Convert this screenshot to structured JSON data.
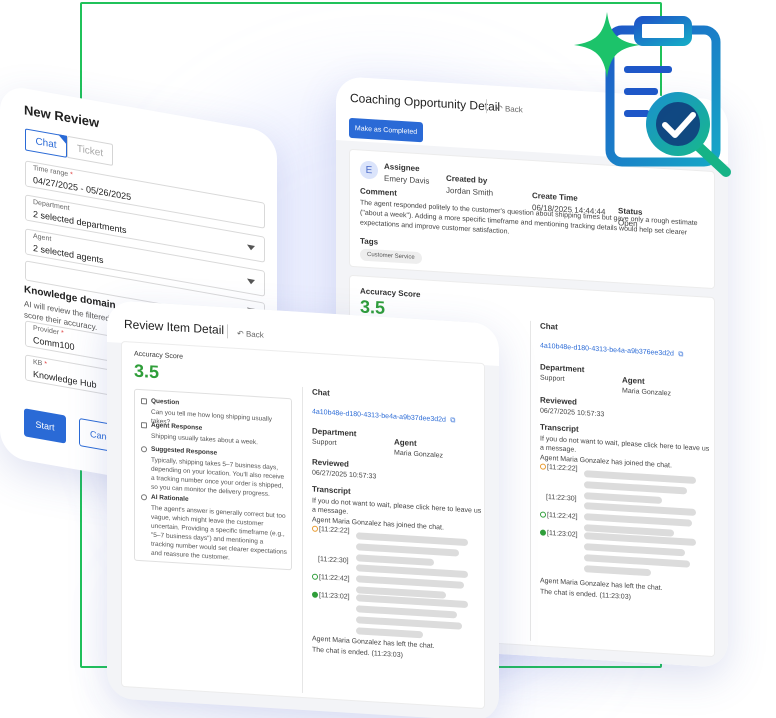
{
  "new_review": {
    "title": "New Review",
    "tabs": {
      "chat": "Chat",
      "ticket": "Ticket"
    },
    "time_range": {
      "label": "Time range",
      "value": "04/27/2025 - 05/26/2025"
    },
    "department": {
      "label": "Department",
      "value": "2 selected departments"
    },
    "agent": {
      "label": "Agent",
      "value": "2 selected agents"
    },
    "knowledge_domain": {
      "title": "Knowledge domain",
      "desc": "AI will review the filtered chats against your knowledge base and score their accuracy."
    },
    "provider": {
      "label": "Provider",
      "value": "Comm100"
    },
    "kb": {
      "label": "KB",
      "value": "Knowledge Hub"
    },
    "start": "Start",
    "cancel": "Cancel"
  },
  "coaching": {
    "title": "Coaching Opportunity Detail",
    "back": "Back",
    "mark_completed": "Make as Completed",
    "assignee": {
      "label": "Assignee",
      "value": "Emery Davis",
      "initial": "E"
    },
    "created_by": {
      "label": "Created by",
      "value": "Jordan Smith"
    },
    "create_time": {
      "label": "Create Time",
      "value": "06/18/2025 14:44:44"
    },
    "status": {
      "label": "Status",
      "value": "Open"
    },
    "comment": {
      "label": "Comment",
      "value": "The agent responded politely to the customer's question about shipping times but gave only a rough estimate (\"about a week\"). Adding a more specific timeframe and mentioning tracking details would help set clearer expectations and improve customer satisfaction."
    },
    "tags": {
      "label": "Tags",
      "value": "Customer Service"
    },
    "accuracy": {
      "label": "Accuracy Score",
      "value": "3.5"
    },
    "chat": {
      "label": "Chat",
      "id": "4a10b48e-d180-4313-be4a-a9b376ee3d2d"
    },
    "department": {
      "label": "Department",
      "value": "Support"
    },
    "agent": {
      "label": "Agent",
      "value": "Maria Gonzalez"
    },
    "reviewed": {
      "label": "Reviewed",
      "value": "06/27/2025 10:57:33"
    },
    "transcript": {
      "label": "Transcript",
      "intro": "If you do not want to wait, please click here to leave us a message.",
      "joined": "Agent Maria Gonzalez has joined the chat.",
      "times": [
        "[11:22:22]",
        "[11:22:30]",
        "[11:22:42]",
        "[11:23:02]"
      ],
      "left": "Agent Maria Gonzalez has left the chat.",
      "ended": "The chat is ended. (11:23:03)"
    }
  },
  "review_item": {
    "title": "Review Item Detail",
    "back": "Back",
    "accuracy": {
      "label": "Accuracy Score",
      "value": "3.5"
    },
    "question": {
      "label": "Question",
      "value": "Can you tell me how long shipping usually takes?"
    },
    "agent_response": {
      "label": "Agent Response",
      "value": "Shipping usually takes about a week."
    },
    "suggested_response": {
      "label": "Suggested Response",
      "value": "Typically, shipping takes 5–7 business days, depending on your location. You'll also receive a tracking number once your order is shipped, so you can monitor the delivery progress."
    },
    "ai_rationale": {
      "label": "AI Rationale",
      "value": "The agent's answer is generally correct but too vague, which might leave the customer uncertain. Providing a specific timeframe (e.g., \"5–7 business days\") and mentioning a tracking number would set clearer expectations and reassure the customer."
    },
    "chat": {
      "label": "Chat",
      "id": "4a10b48e-d180-4313-be4a-a9b37dee3d2d"
    },
    "department": {
      "label": "Department",
      "value": "Support"
    },
    "agent": {
      "label": "Agent",
      "value": "Maria Gonzalez"
    },
    "reviewed": {
      "label": "Reviewed",
      "value": "06/27/2025 10:57:33"
    },
    "transcript": {
      "label": "Transcript",
      "intro": "If you do not want to wait, please click here to leave us a message.",
      "joined": "Agent Maria Gonzalez has joined the chat.",
      "times": [
        "[11:22:22]",
        "[11:22:30]",
        "[11:22:42]",
        "[11:23:02]"
      ],
      "left": "Agent Maria Gonzalez has left the chat.",
      "ended": "The chat is ended. (11:23:03)"
    }
  },
  "colors": {
    "primary": "#2a6ad6",
    "accent_green": "#20c25a",
    "score_green": "#2f9e3a"
  },
  "icons": [
    "sparkle-icon",
    "clipboard-check-icon",
    "back-arrow-icon",
    "external-link-icon",
    "chevron-down-icon"
  ]
}
